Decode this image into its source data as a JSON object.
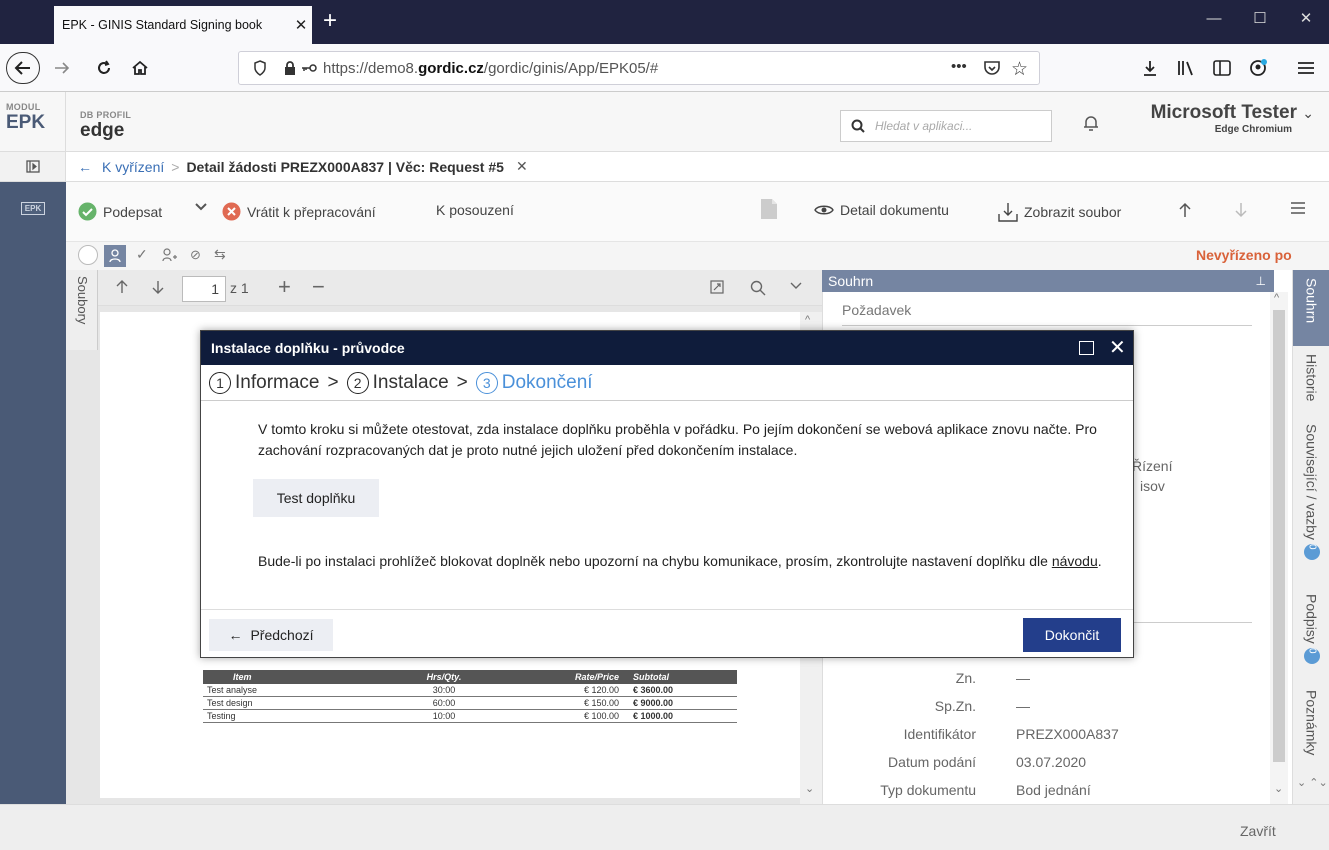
{
  "browser": {
    "tab_title": "EPK - GINIS Standard Signing book",
    "url_prefix": "https://demo8.",
    "url_host": "gordic.cz",
    "url_path": "/gordic/ginis/App/EPK05/#",
    "url_menu_dots": "•••"
  },
  "app": {
    "module_label": "MODUL",
    "module_value": "EPK",
    "profile_label": "DB PROFIL",
    "profile_value": "edge",
    "search_placeholder": "Hledat v aplikaci...",
    "user_name": "Microsoft Tester",
    "user_sub": "Edge Chromium",
    "rail_badge": "EPK"
  },
  "breadcrumb": {
    "link": "K vyřízení",
    "separator": ">",
    "current": "Detail žádosti PREZX000A837 | Věc: Request #5"
  },
  "toolbar": {
    "sign": "Podepsat",
    "return": "Vrátit k přepracování",
    "review": "K posouzení",
    "doc_detail": "Detail dokumentu",
    "show_file": "Zobrazit soubor"
  },
  "viewer": {
    "status": "Nevyřízeno po",
    "files_tab": "Soubory",
    "page_current": "1",
    "page_of": "z 1"
  },
  "invoice": {
    "headers": [
      "Item",
      "Hrs/Qty.",
      "Rate/Price",
      "Subtotal"
    ],
    "rows": [
      [
        "Test analyse",
        "30:00",
        "€ 120.00",
        "€ 3600.00"
      ],
      [
        "Test design",
        "60:00",
        "€ 150.00",
        "€ 9000.00"
      ],
      [
        "Testing",
        "10:00",
        "€ 100.00",
        "€ 1000.00"
      ]
    ]
  },
  "summary_panel": {
    "title": "Souhrn",
    "request_label": "Požadavek",
    "partial_1": "Řízení",
    "partial_2": "isov",
    "fields": [
      {
        "label": "Zn.",
        "value": "—"
      },
      {
        "label": "Sp.Zn.",
        "value": "—"
      },
      {
        "label": "Identifikátor",
        "value": "PREZX000A837"
      },
      {
        "label": "Datum podání",
        "value": "03.07.2020"
      },
      {
        "label": "Typ dokumentu",
        "value": "Bod jednání"
      }
    ]
  },
  "side_tabs": {
    "summary": "Souhrn",
    "history": "Historie",
    "related": "Související / vazby",
    "related_count": "0",
    "signatures": "Podpisy",
    "signatures_count": "0",
    "notes": "Poznámky"
  },
  "bottom": {
    "close": "Zavřít"
  },
  "modal": {
    "title": "Instalace doplňku - průvodce",
    "steps": [
      {
        "num": "1",
        "label": "Informace"
      },
      {
        "num": "2",
        "label": "Instalace"
      },
      {
        "num": "3",
        "label": "Dokončení"
      }
    ],
    "step_sep": ">",
    "text1": "V tomto kroku si můžete otestovat, zda instalace doplňku proběhla v pořádku. Po jejím dokončení se webová aplikace znovu načte. Pro zachování rozpracovaných dat je proto nutné jejich uložení před dokončením instalace.",
    "test_button": "Test doplňku",
    "text2_prefix": "Bude-li po instalaci prohlížeč blokovat doplněk nebo upozorní na chybu komunikace, prosím, zkontrolujte nastavení doplňku dle ",
    "text2_link": "návodu",
    "text2_suffix": ".",
    "prev_button": "Předchozí",
    "finish_button": "Dokončit"
  },
  "colors": {
    "titlebar": "#202340",
    "modal_header": "#0f1c3b",
    "primary_button": "#233e8b",
    "status_orange": "#d9623a",
    "panel_header": "#7585a2",
    "rail": "#4a5a76"
  }
}
